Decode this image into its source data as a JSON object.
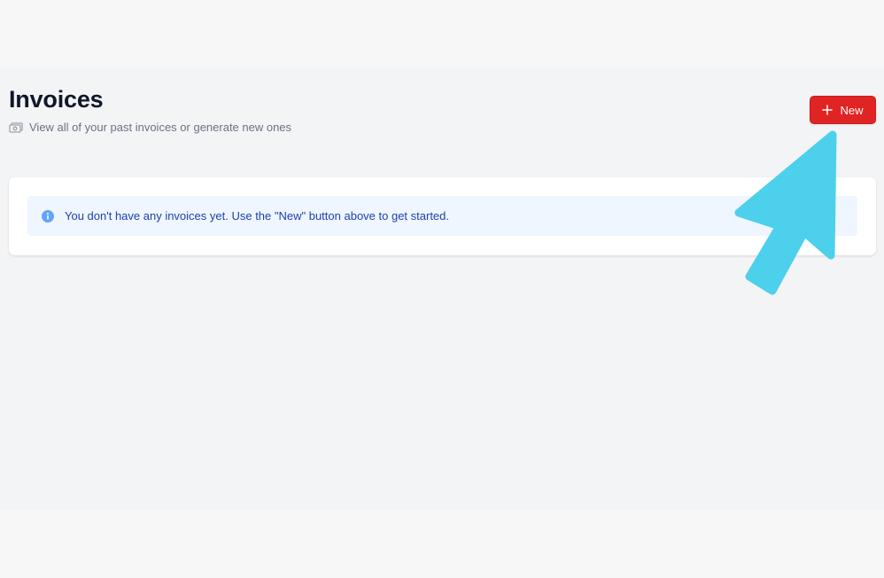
{
  "header": {
    "title": "Invoices",
    "subtitle": "View all of your past invoices or generate new ones",
    "subtitle_icon": "cash-icon"
  },
  "actions": {
    "new_label": "New",
    "new_icon": "plus-icon"
  },
  "empty_state": {
    "icon": "info-icon",
    "message": "You don't have any invoices yet. Use the \"New\" button above to get started."
  },
  "annotation": {
    "icon": "pointer-arrow-icon"
  },
  "colors": {
    "page_background": "#f3f4f6",
    "title_text": "#0f172a",
    "subtitle_text": "#6b7280",
    "primary_button": "#e02424",
    "alert_background": "#eff6ff",
    "alert_text": "#1e40af",
    "info_icon": "#60a5fa",
    "arrow": "#4dd0ec"
  }
}
